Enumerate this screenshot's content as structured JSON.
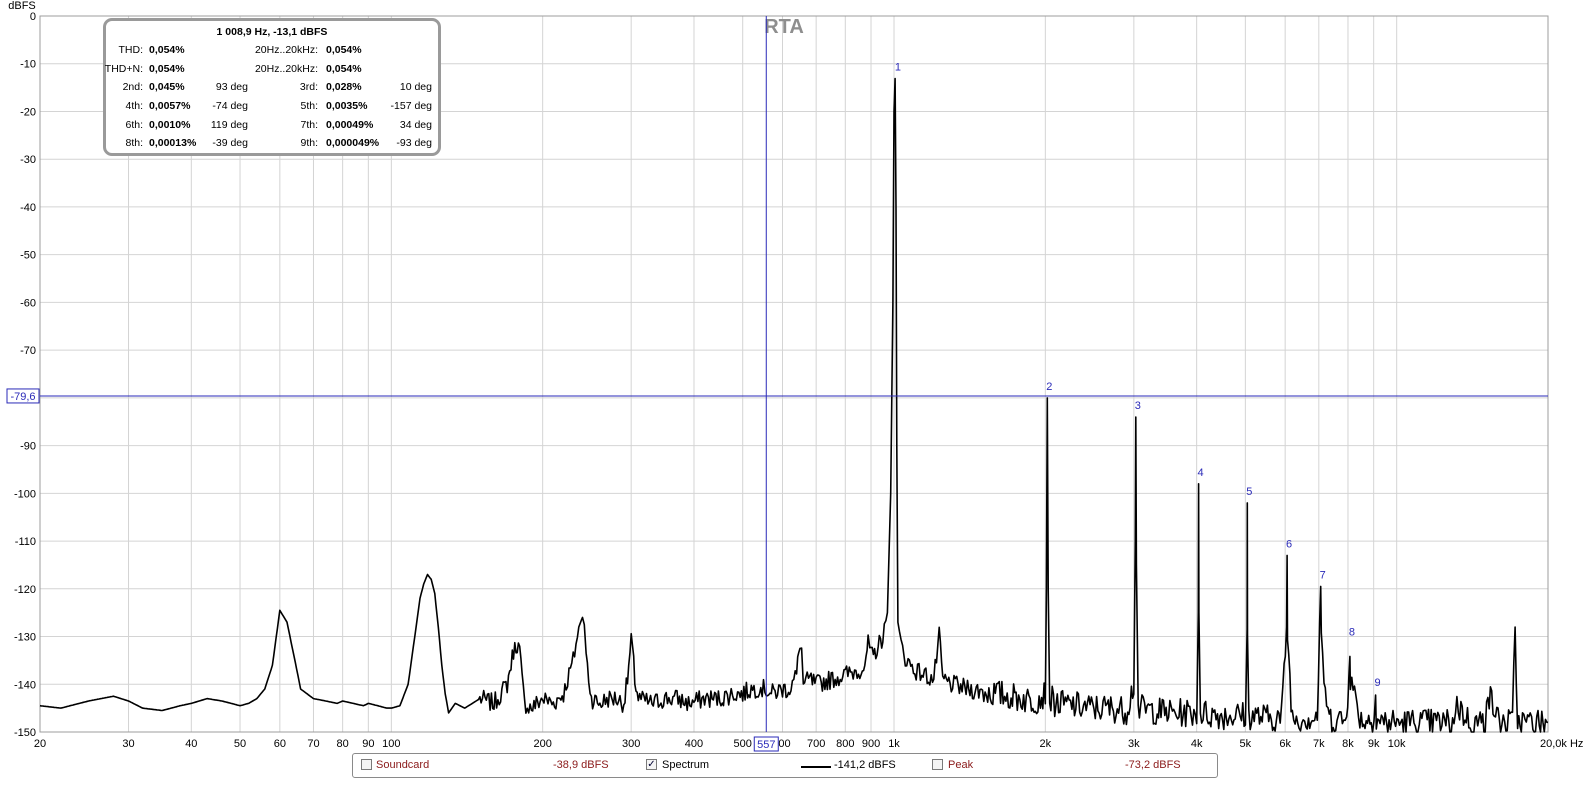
{
  "chart_data": {
    "type": "line",
    "title": "RTA",
    "ylabel": "dBFS",
    "xunit": "Hz",
    "xscale": "log",
    "xlim": [
      20,
      20000
    ],
    "ylim": [
      -150,
      0
    ],
    "y_ticks": [
      "0",
      "-10",
      "-20",
      "-30",
      "-40",
      "-50",
      "-60",
      "-70",
      "-90",
      "-100",
      "-110",
      "-120",
      "-130",
      "-140",
      "-150"
    ],
    "x_ticks": [
      {
        "v": 20,
        "label": "20"
      },
      {
        "v": 30,
        "label": "30"
      },
      {
        "v": 40,
        "label": "40"
      },
      {
        "v": 50,
        "label": "50"
      },
      {
        "v": 60,
        "label": "60"
      },
      {
        "v": 70,
        "label": "70"
      },
      {
        "v": 80,
        "label": "80"
      },
      {
        "v": 90,
        "label": "90"
      },
      {
        "v": 100,
        "label": "100"
      },
      {
        "v": 200,
        "label": "200"
      },
      {
        "v": 300,
        "label": "300"
      },
      {
        "v": 400,
        "label": "400"
      },
      {
        "v": 500,
        "label": "500"
      },
      {
        "v": 600,
        "label": "00"
      },
      {
        "v": 700,
        "label": "700"
      },
      {
        "v": 800,
        "label": "800"
      },
      {
        "v": 900,
        "label": "900"
      },
      {
        "v": 1000,
        "label": "1k"
      },
      {
        "v": 2000,
        "label": "2k"
      },
      {
        "v": 3000,
        "label": "3k"
      },
      {
        "v": 4000,
        "label": "4k"
      },
      {
        "v": 5000,
        "label": "5k"
      },
      {
        "v": 6000,
        "label": "6k"
      },
      {
        "v": 7000,
        "label": "7k"
      },
      {
        "v": 8000,
        "label": "8k"
      },
      {
        "v": 9000,
        "label": "9k"
      },
      {
        "v": 10000,
        "label": "10k"
      },
      {
        "v": 20000,
        "label": "20,0k Hz"
      }
    ],
    "grid": true,
    "cursor": {
      "x": 557,
      "x_label": "557",
      "y": -79.6,
      "y_label": "-79,6"
    },
    "harmonics": [
      {
        "label": "1",
        "freq": 1009,
        "db": -13.1
      },
      {
        "label": "2",
        "freq": 2018,
        "db": -80.0
      },
      {
        "label": "3",
        "freq": 3027,
        "db": -84.0
      },
      {
        "label": "4",
        "freq": 4036,
        "db": -98.0
      },
      {
        "label": "5",
        "freq": 5045,
        "db": -102.0
      },
      {
        "label": "6",
        "freq": 6053,
        "db": -113.0
      },
      {
        "label": "7",
        "freq": 7062,
        "db": -119.5
      },
      {
        "label": "8",
        "freq": 8071,
        "db": -131.5
      },
      {
        "label": "9",
        "freq": 9080,
        "db": -142.0
      }
    ],
    "series": [
      {
        "name": "Spectrum",
        "color": "#000000",
        "x": [
          20,
          22,
          25,
          28,
          30,
          32,
          35,
          38,
          40,
          43,
          46,
          48,
          50,
          52,
          54,
          56,
          58,
          60,
          62,
          64,
          66,
          70,
          74,
          78,
          80,
          84,
          88,
          90,
          94,
          98,
          100,
          104,
          108,
          112,
          114,
          116,
          118,
          120,
          122,
          124,
          126,
          128,
          130,
          134,
          140,
          150,
          160,
          170,
          175,
          178,
          180,
          182,
          184,
          190,
          200,
          210,
          220,
          230,
          236,
          240,
          242,
          244,
          250,
          260,
          270,
          280,
          290,
          295,
          300,
          302,
          305,
          310,
          330,
          350,
          370,
          390,
          420,
          450,
          480,
          500,
          520,
          530,
          540,
          550,
          557,
          570,
          600,
          620,
          640,
          650,
          655,
          660,
          680,
          700,
          750,
          800,
          850,
          880,
          888,
          895,
          910,
          930,
          950,
          970,
          985,
          995,
          1000,
          1005,
          1009,
          1013,
          1018,
          1025,
          1040,
          1060,
          1100,
          1150,
          1200,
          1230,
          1250,
          1300,
          1400,
          1500,
          1600,
          1700,
          1800,
          1900,
          2000,
          2010,
          2018,
          2026,
          2040,
          2100,
          2300,
          2500,
          2700,
          2900,
          3000,
          3020,
          3027,
          3035,
          3060,
          3300,
          3600,
          3900,
          4000,
          4030,
          4036,
          4042,
          4070,
          4400,
          4800,
          5000,
          5040,
          5045,
          5050,
          5080,
          5500,
          5900,
          6040,
          6053,
          6065,
          6200,
          6600,
          6950,
          7062,
          7080,
          7300,
          7700,
          7950,
          8071,
          8090,
          8500,
          8950,
          9080,
          9110,
          9600,
          10500,
          12000,
          13000,
          13100,
          14000,
          15000,
          15100,
          16000,
          17000,
          17200,
          17400,
          18000,
          19000,
          20000
        ],
        "y": [
          -144.5,
          -145,
          -143.5,
          -142.5,
          -143.5,
          -145,
          -145.5,
          -144.5,
          -144,
          -143,
          -143.5,
          -144,
          -144.5,
          -144,
          -143,
          -141,
          -136,
          -124.5,
          -127,
          -134,
          -141,
          -143,
          -143.5,
          -144,
          -143.5,
          -144,
          -144.5,
          -144,
          -144.5,
          -145,
          -145,
          -144.5,
          -140,
          -128,
          -122,
          -119,
          -117,
          -118,
          -121,
          -128,
          -136,
          -142,
          -146,
          -144,
          -145,
          -143,
          -144,
          -140,
          -133,
          -131.5,
          -133,
          -139,
          -144,
          -145,
          -143,
          -144,
          -142,
          -135,
          -128,
          -126,
          -127.5,
          -134,
          -143,
          -144,
          -143,
          -143,
          -144,
          -139,
          -131,
          -133,
          -139,
          -143,
          -144,
          -143,
          -143,
          -144,
          -143,
          -143,
          -142,
          -142,
          -141,
          -141,
          -140.5,
          -141,
          -141,
          -142,
          -141,
          -141,
          -138,
          -131,
          -133,
          -140,
          -139,
          -140,
          -139,
          -138,
          -137,
          -136,
          -130,
          -134,
          -134,
          -132,
          -130,
          -125,
          -100,
          -60,
          -20,
          -13.1,
          -40,
          -90,
          -127,
          -130,
          -133,
          -135,
          -137,
          -138,
          -139,
          -130,
          -139,
          -140,
          -141,
          -141.5,
          -142,
          -142.5,
          -143,
          -143.5,
          -142,
          -120,
          -80,
          -120,
          -143,
          -144,
          -144.5,
          -145,
          -145,
          -145.5,
          -140,
          -110,
          -84,
          -115,
          -145,
          -145.5,
          -146,
          -146,
          -146,
          -125,
          -98,
          -125,
          -146,
          -146.5,
          -146.5,
          -146.5,
          -130,
          -102,
          -130,
          -146.5,
          -147,
          -147,
          -128,
          -113,
          -130,
          -147,
          -147,
          -147,
          -119.5,
          -132,
          -147,
          -147.5,
          -147.5,
          -131.5,
          -139,
          -147.5,
          -147.5,
          -142,
          -147.5,
          -148,
          -148,
          -148,
          -148,
          -144,
          -148,
          -148,
          -141,
          -148,
          -148,
          -128,
          -148,
          -148,
          -148,
          -148
        ]
      }
    ]
  },
  "summary": {
    "header": "1 008,9 Hz, -13,1 dBFS",
    "rows": [
      {
        "l1": "THD:",
        "v1": "0,054%",
        "p1": "",
        "l2": "20Hz..20kHz:",
        "v2": "0,054%",
        "p2": ""
      },
      {
        "l1": "THD+N:",
        "v1": "0,054%",
        "p1": "",
        "l2": "20Hz..20kHz:",
        "v2": "0,054%",
        "p2": ""
      },
      {
        "l1": "2nd:",
        "v1": "0,045%",
        "p1": "93 deg",
        "l2": "3rd:",
        "v2": "0,028%",
        "p2": "10 deg"
      },
      {
        "l1": "4th:",
        "v1": "0,0057%",
        "p1": "-74 deg",
        "l2": "5th:",
        "v2": "0,0035%",
        "p2": "-157 deg"
      },
      {
        "l1": "6th:",
        "v1": "0,0010%",
        "p1": "119 deg",
        "l2": "7th:",
        "v2": "0,00049%",
        "p2": "34 deg"
      },
      {
        "l1": "8th:",
        "v1": "0,00013%",
        "p1": "-39 deg",
        "l2": "9th:",
        "v2": "0,000049%",
        "p2": "-93 deg"
      }
    ]
  },
  "legend": {
    "soundcard_label": "Soundcard",
    "soundcard_value": "-38,9 dBFS",
    "soundcard_checked": false,
    "spectrum_label": "Spectrum",
    "spectrum_checked": true,
    "spectrum_value": "-141,2 dBFS",
    "peak_label": "Peak",
    "peak_value": "-73,2 dBFS",
    "peak_checked": false
  },
  "colors": {
    "grid": "#d4d4d4",
    "cursor": "#2a2ab8",
    "trace": "#000000",
    "harmonic_label": "#2a2ab8",
    "value_red": "#8b1a1a"
  }
}
